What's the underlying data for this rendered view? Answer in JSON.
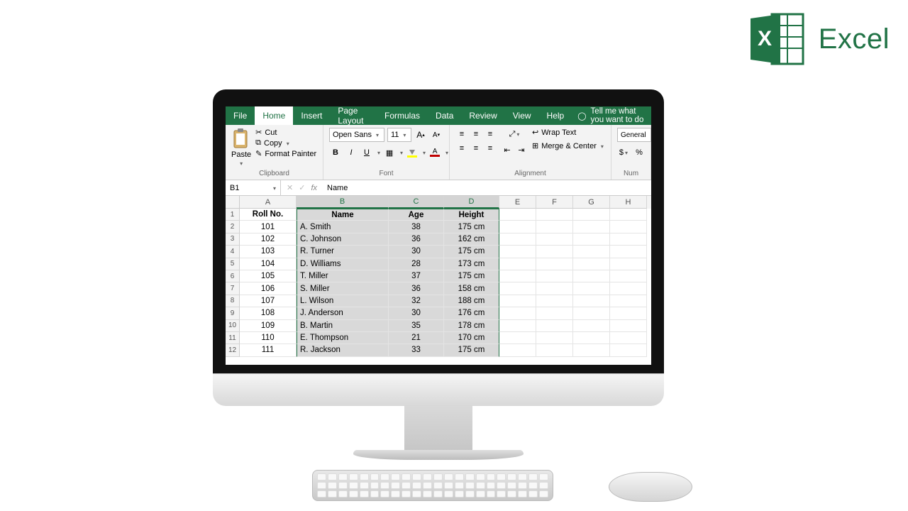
{
  "logo_text": "Excel",
  "tabs": [
    "File",
    "Home",
    "Insert",
    "Page Layout",
    "Formulas",
    "Data",
    "Review",
    "View",
    "Help"
  ],
  "active_tab": "Home",
  "tell_me": "Tell me what you want to do",
  "ribbon": {
    "clipboard": {
      "label": "Clipboard",
      "paste": "Paste",
      "cut": "Cut",
      "copy": "Copy",
      "format_painter": "Format Painter"
    },
    "font": {
      "label": "Font",
      "name": "Open Sans",
      "size": "11"
    },
    "alignment": {
      "label": "Alignment",
      "wrap": "Wrap Text",
      "merge": "Merge & Center"
    },
    "number": {
      "label": "Num",
      "format": "General",
      "percent": "%"
    }
  },
  "formula_bar": {
    "cell": "B1",
    "value": "Name"
  },
  "columns": [
    "A",
    "B",
    "C",
    "D",
    "E",
    "F",
    "G",
    "H"
  ],
  "headers": {
    "A": "Roll No.",
    "B": "Name",
    "C": "Age",
    "D": "Height"
  },
  "rows": [
    {
      "n": 1
    },
    {
      "n": 2,
      "A": "101",
      "B": "A. Smith",
      "C": "38",
      "D": "175 cm"
    },
    {
      "n": 3,
      "A": "102",
      "B": "C. Johnson",
      "C": "36",
      "D": "162 cm"
    },
    {
      "n": 4,
      "A": "103",
      "B": "R. Turner",
      "C": "30",
      "D": "175 cm"
    },
    {
      "n": 5,
      "A": "104",
      "B": "D. Williams",
      "C": "28",
      "D": "173 cm"
    },
    {
      "n": 6,
      "A": "105",
      "B": "T. Miller",
      "C": "37",
      "D": "175 cm"
    },
    {
      "n": 7,
      "A": "106",
      "B": "S. Miller",
      "C": "36",
      "D": "158 cm"
    },
    {
      "n": 8,
      "A": "107",
      "B": "L. Wilson",
      "C": "32",
      "D": "188 cm"
    },
    {
      "n": 9,
      "A": "108",
      "B": "J. Anderson",
      "C": "30",
      "D": "176 cm"
    },
    {
      "n": 10,
      "A": "109",
      "B": "B. Martin",
      "C": "35",
      "D": "178 cm"
    },
    {
      "n": 11,
      "A": "110",
      "B": "E. Thompson",
      "C": "21",
      "D": "170 cm"
    },
    {
      "n": 12,
      "A": "111",
      "B": "R. Jackson",
      "C": "33",
      "D": "175 cm"
    }
  ]
}
